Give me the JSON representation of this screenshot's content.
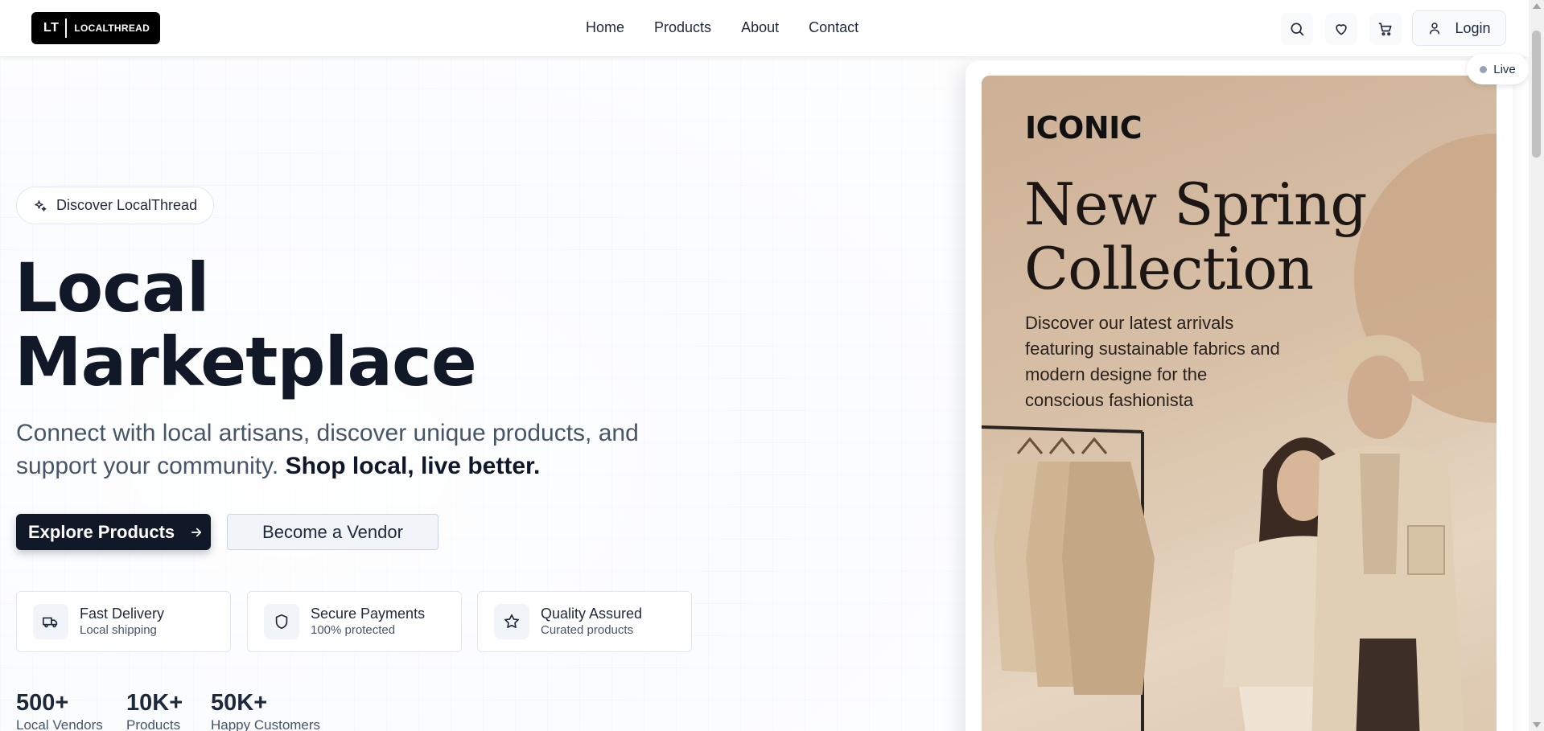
{
  "brand": {
    "mark": "LT",
    "name": "LOCALTHREAD"
  },
  "nav": {
    "items": [
      {
        "label": "Home"
      },
      {
        "label": "Products"
      },
      {
        "label": "About"
      },
      {
        "label": "Contact"
      }
    ]
  },
  "header_actions": {
    "search_icon": "search-icon",
    "wishlist_icon": "heart-icon",
    "cart_icon": "cart-icon",
    "login_label": "Login"
  },
  "hero": {
    "badge": "Discover LocalThread",
    "title_line1": "Local",
    "title_line2": "Marketplace",
    "subtitle": "Connect with local artisans, discover unique products, and support your community.",
    "subtitle_emphasis": "Shop local, live better.",
    "primary_cta": "Explore Products",
    "secondary_cta": "Become a Vendor",
    "features": [
      {
        "title": "Fast Delivery",
        "subtitle": "Local shipping",
        "icon": "truck-icon"
      },
      {
        "title": "Secure Payments",
        "subtitle": "100% protected",
        "icon": "shield-icon"
      },
      {
        "title": "Quality Assured",
        "subtitle": "Curated products",
        "icon": "star-icon"
      }
    ],
    "stats": [
      {
        "value": "500+",
        "label": "Local Vendors"
      },
      {
        "value": "10K+",
        "label": "Products"
      },
      {
        "value": "50K+",
        "label": "Happy Customers"
      }
    ]
  },
  "promo": {
    "live_label": "Live",
    "brand": "ICONIC",
    "title_line1": "New Spring",
    "title_line2": "Collection",
    "description": "Discover our latest arrivals featuring sustainable fabrics and modern designe for the conscious fashionista"
  },
  "colors": {
    "primary": "#111827",
    "text": "#1e293b",
    "muted": "#475569",
    "promo_bg": "#d8c1a8"
  }
}
